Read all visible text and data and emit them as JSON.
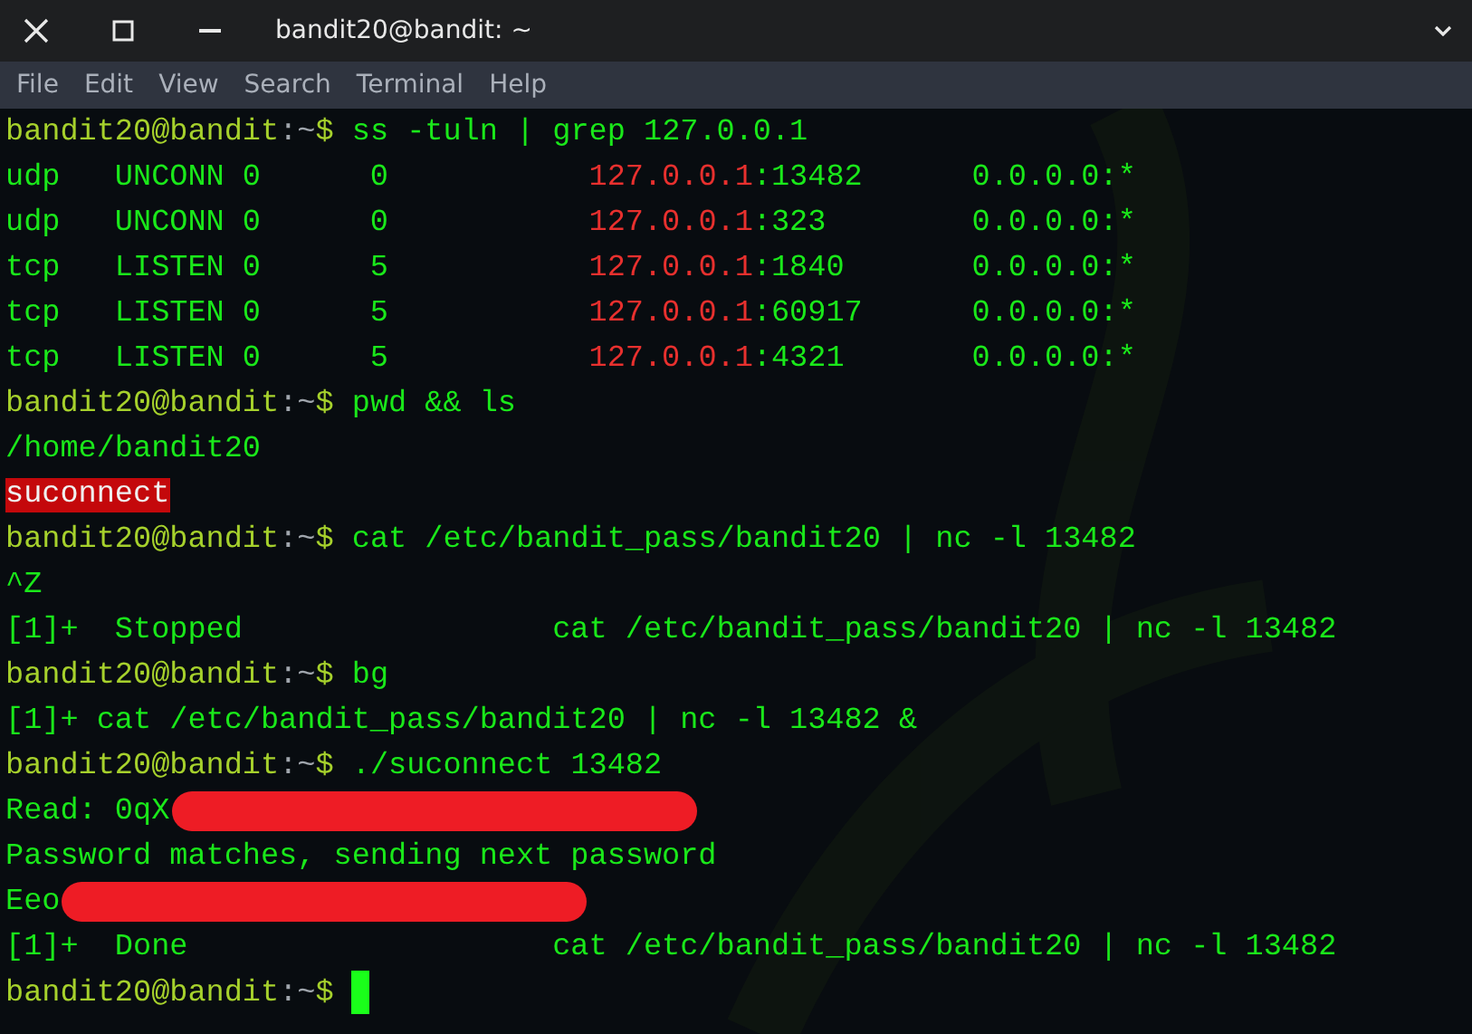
{
  "window": {
    "title": "bandit20@bandit: ~"
  },
  "menu": [
    {
      "label": "File"
    },
    {
      "label": "Edit"
    },
    {
      "label": "View"
    },
    {
      "label": "Search"
    },
    {
      "label": "Terminal"
    },
    {
      "label": "Help"
    }
  ],
  "terminal": {
    "lines": [
      {
        "segments": [
          {
            "kind": "user",
            "text": "bandit20@bandit"
          },
          {
            "kind": "dim",
            "text": ":~"
          },
          {
            "kind": "user",
            "text": "$"
          },
          {
            "kind": "cmd",
            "text": " ss -tuln | grep 127.0.0.1"
          }
        ]
      },
      {
        "segments": [
          {
            "kind": "cmd",
            "text": "udp   UNCONN 0      0           "
          },
          {
            "kind": "ip",
            "text": "127.0.0.1"
          },
          {
            "kind": "cmd",
            "text": ":13482      0.0.0.0:*"
          }
        ]
      },
      {
        "segments": [
          {
            "kind": "cmd",
            "text": "udp   UNCONN 0      0           "
          },
          {
            "kind": "ip",
            "text": "127.0.0.1"
          },
          {
            "kind": "cmd",
            "text": ":323        0.0.0.0:*"
          }
        ]
      },
      {
        "segments": [
          {
            "kind": "cmd",
            "text": "tcp   LISTEN 0      5           "
          },
          {
            "kind": "ip",
            "text": "127.0.0.1"
          },
          {
            "kind": "cmd",
            "text": ":1840       0.0.0.0:*"
          }
        ]
      },
      {
        "segments": [
          {
            "kind": "cmd",
            "text": "tcp   LISTEN 0      5           "
          },
          {
            "kind": "ip",
            "text": "127.0.0.1"
          },
          {
            "kind": "cmd",
            "text": ":60917      0.0.0.0:*"
          }
        ]
      },
      {
        "segments": [
          {
            "kind": "cmd",
            "text": "tcp   LISTEN 0      5           "
          },
          {
            "kind": "ip",
            "text": "127.0.0.1"
          },
          {
            "kind": "cmd",
            "text": ":4321       0.0.0.0:*"
          }
        ]
      },
      {
        "segments": [
          {
            "kind": "user",
            "text": "bandit20@bandit"
          },
          {
            "kind": "dim",
            "text": ":~"
          },
          {
            "kind": "user",
            "text": "$"
          },
          {
            "kind": "cmd",
            "text": " pwd && ls"
          }
        ]
      },
      {
        "segments": [
          {
            "kind": "cmd",
            "text": "/home/bandit20"
          }
        ]
      },
      {
        "segments": [
          {
            "kind": "highlight",
            "text": "suconnect"
          }
        ]
      },
      {
        "segments": [
          {
            "kind": "user",
            "text": "bandit20@bandit"
          },
          {
            "kind": "dim",
            "text": ":~"
          },
          {
            "kind": "user",
            "text": "$"
          },
          {
            "kind": "cmd",
            "text": " cat /etc/bandit_pass/bandit20 | nc -l 13482"
          }
        ]
      },
      {
        "segments": [
          {
            "kind": "cmd",
            "text": "^Z"
          }
        ]
      },
      {
        "segments": [
          {
            "kind": "cmd",
            "text": "[1]+  Stopped                 cat /etc/bandit_pass/bandit20 | nc -l 13482"
          }
        ]
      },
      {
        "segments": [
          {
            "kind": "user",
            "text": "bandit20@bandit"
          },
          {
            "kind": "dim",
            "text": ":~"
          },
          {
            "kind": "user",
            "text": "$"
          },
          {
            "kind": "cmd",
            "text": " bg"
          }
        ]
      },
      {
        "segments": [
          {
            "kind": "cmd",
            "text": "[1]+ cat /etc/bandit_pass/bandit20 | nc -l 13482 &"
          }
        ]
      },
      {
        "segments": [
          {
            "kind": "user",
            "text": "bandit20@bandit"
          },
          {
            "kind": "dim",
            "text": ":~"
          },
          {
            "kind": "user",
            "text": "$"
          },
          {
            "kind": "cmd",
            "text": " ./suconnect 13482"
          }
        ]
      },
      {
        "segments": [
          {
            "kind": "cmd",
            "text": "Read: 0qX"
          },
          {
            "kind": "redaction"
          }
        ]
      },
      {
        "segments": [
          {
            "kind": "cmd",
            "text": "Password matches, sending next password"
          }
        ]
      },
      {
        "segments": [
          {
            "kind": "cmd",
            "text": "Eeo"
          },
          {
            "kind": "redaction"
          }
        ]
      },
      {
        "segments": [
          {
            "kind": "cmd",
            "text": "[1]+  Done                    cat /etc/bandit_pass/bandit20 | nc -l 13482"
          }
        ]
      },
      {
        "segments": [
          {
            "kind": "user",
            "text": "bandit20@bandit"
          },
          {
            "kind": "dim",
            "text": ":~"
          },
          {
            "kind": "user",
            "text": "$"
          },
          {
            "kind": "cursor"
          }
        ]
      }
    ]
  }
}
